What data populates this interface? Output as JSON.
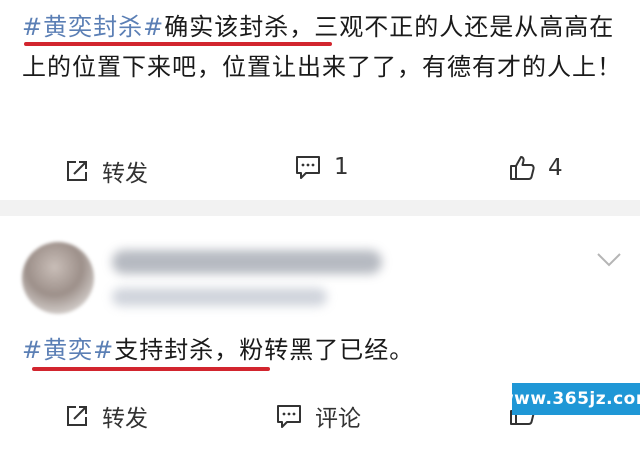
{
  "post1": {
    "hashtag": "#黄奕封杀#",
    "text": "确实该封杀，三观不正的人还是从高高在上的位置下来吧，位置让出来了了，有德有才的人上！",
    "actions": {
      "repost_label": "转发",
      "comment_count": "1",
      "like_count": "4"
    }
  },
  "post2": {
    "hashtag": "#黄奕#",
    "text": "支持封杀，粉转黑了已经。",
    "actions": {
      "repost_label": "转发",
      "comment_label": "评论"
    }
  },
  "icons": {
    "repost": "repost-icon",
    "comment": "comment-icon",
    "like": "like-icon",
    "more": "chevron-down-icon"
  },
  "colors": {
    "hashtag": "#5b7fb5",
    "underline": "#d2252e",
    "watermark_bg": "#1f97d6"
  },
  "watermark": "www.365jz.com"
}
